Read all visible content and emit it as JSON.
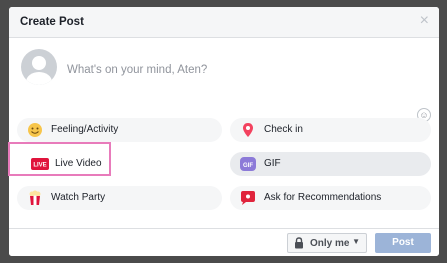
{
  "dialog": {
    "title": "Create Post",
    "close_glyph": "×"
  },
  "composer": {
    "placeholder": "What's on your mind, Aten?"
  },
  "emoji_glyph": "☺",
  "options": {
    "feeling": "Feeling/Activity",
    "checkin": "Check in",
    "live": "Live Video",
    "live_badge": "LIVE",
    "gif": "GIF",
    "gif_badge": "GIF",
    "watch_party": "Watch Party",
    "recommendations": "Ask for Recommendations"
  },
  "footer": {
    "privacy_label": "Only me",
    "caret_glyph": "▼",
    "post_label": "Post"
  },
  "icons": {
    "feeling": "feeling-emoji-icon",
    "checkin": "map-pin-icon",
    "live": "live-video-icon",
    "gif": "gif-icon",
    "watch_party": "popcorn-icon",
    "recommendations": "speech-bubble-icon",
    "privacy": "lock-icon",
    "close": "close-icon"
  },
  "colors": {
    "highlight_border": "#e87bbb",
    "post_button_disabled": "#9cb4d8",
    "live_red": "#e0143c"
  }
}
